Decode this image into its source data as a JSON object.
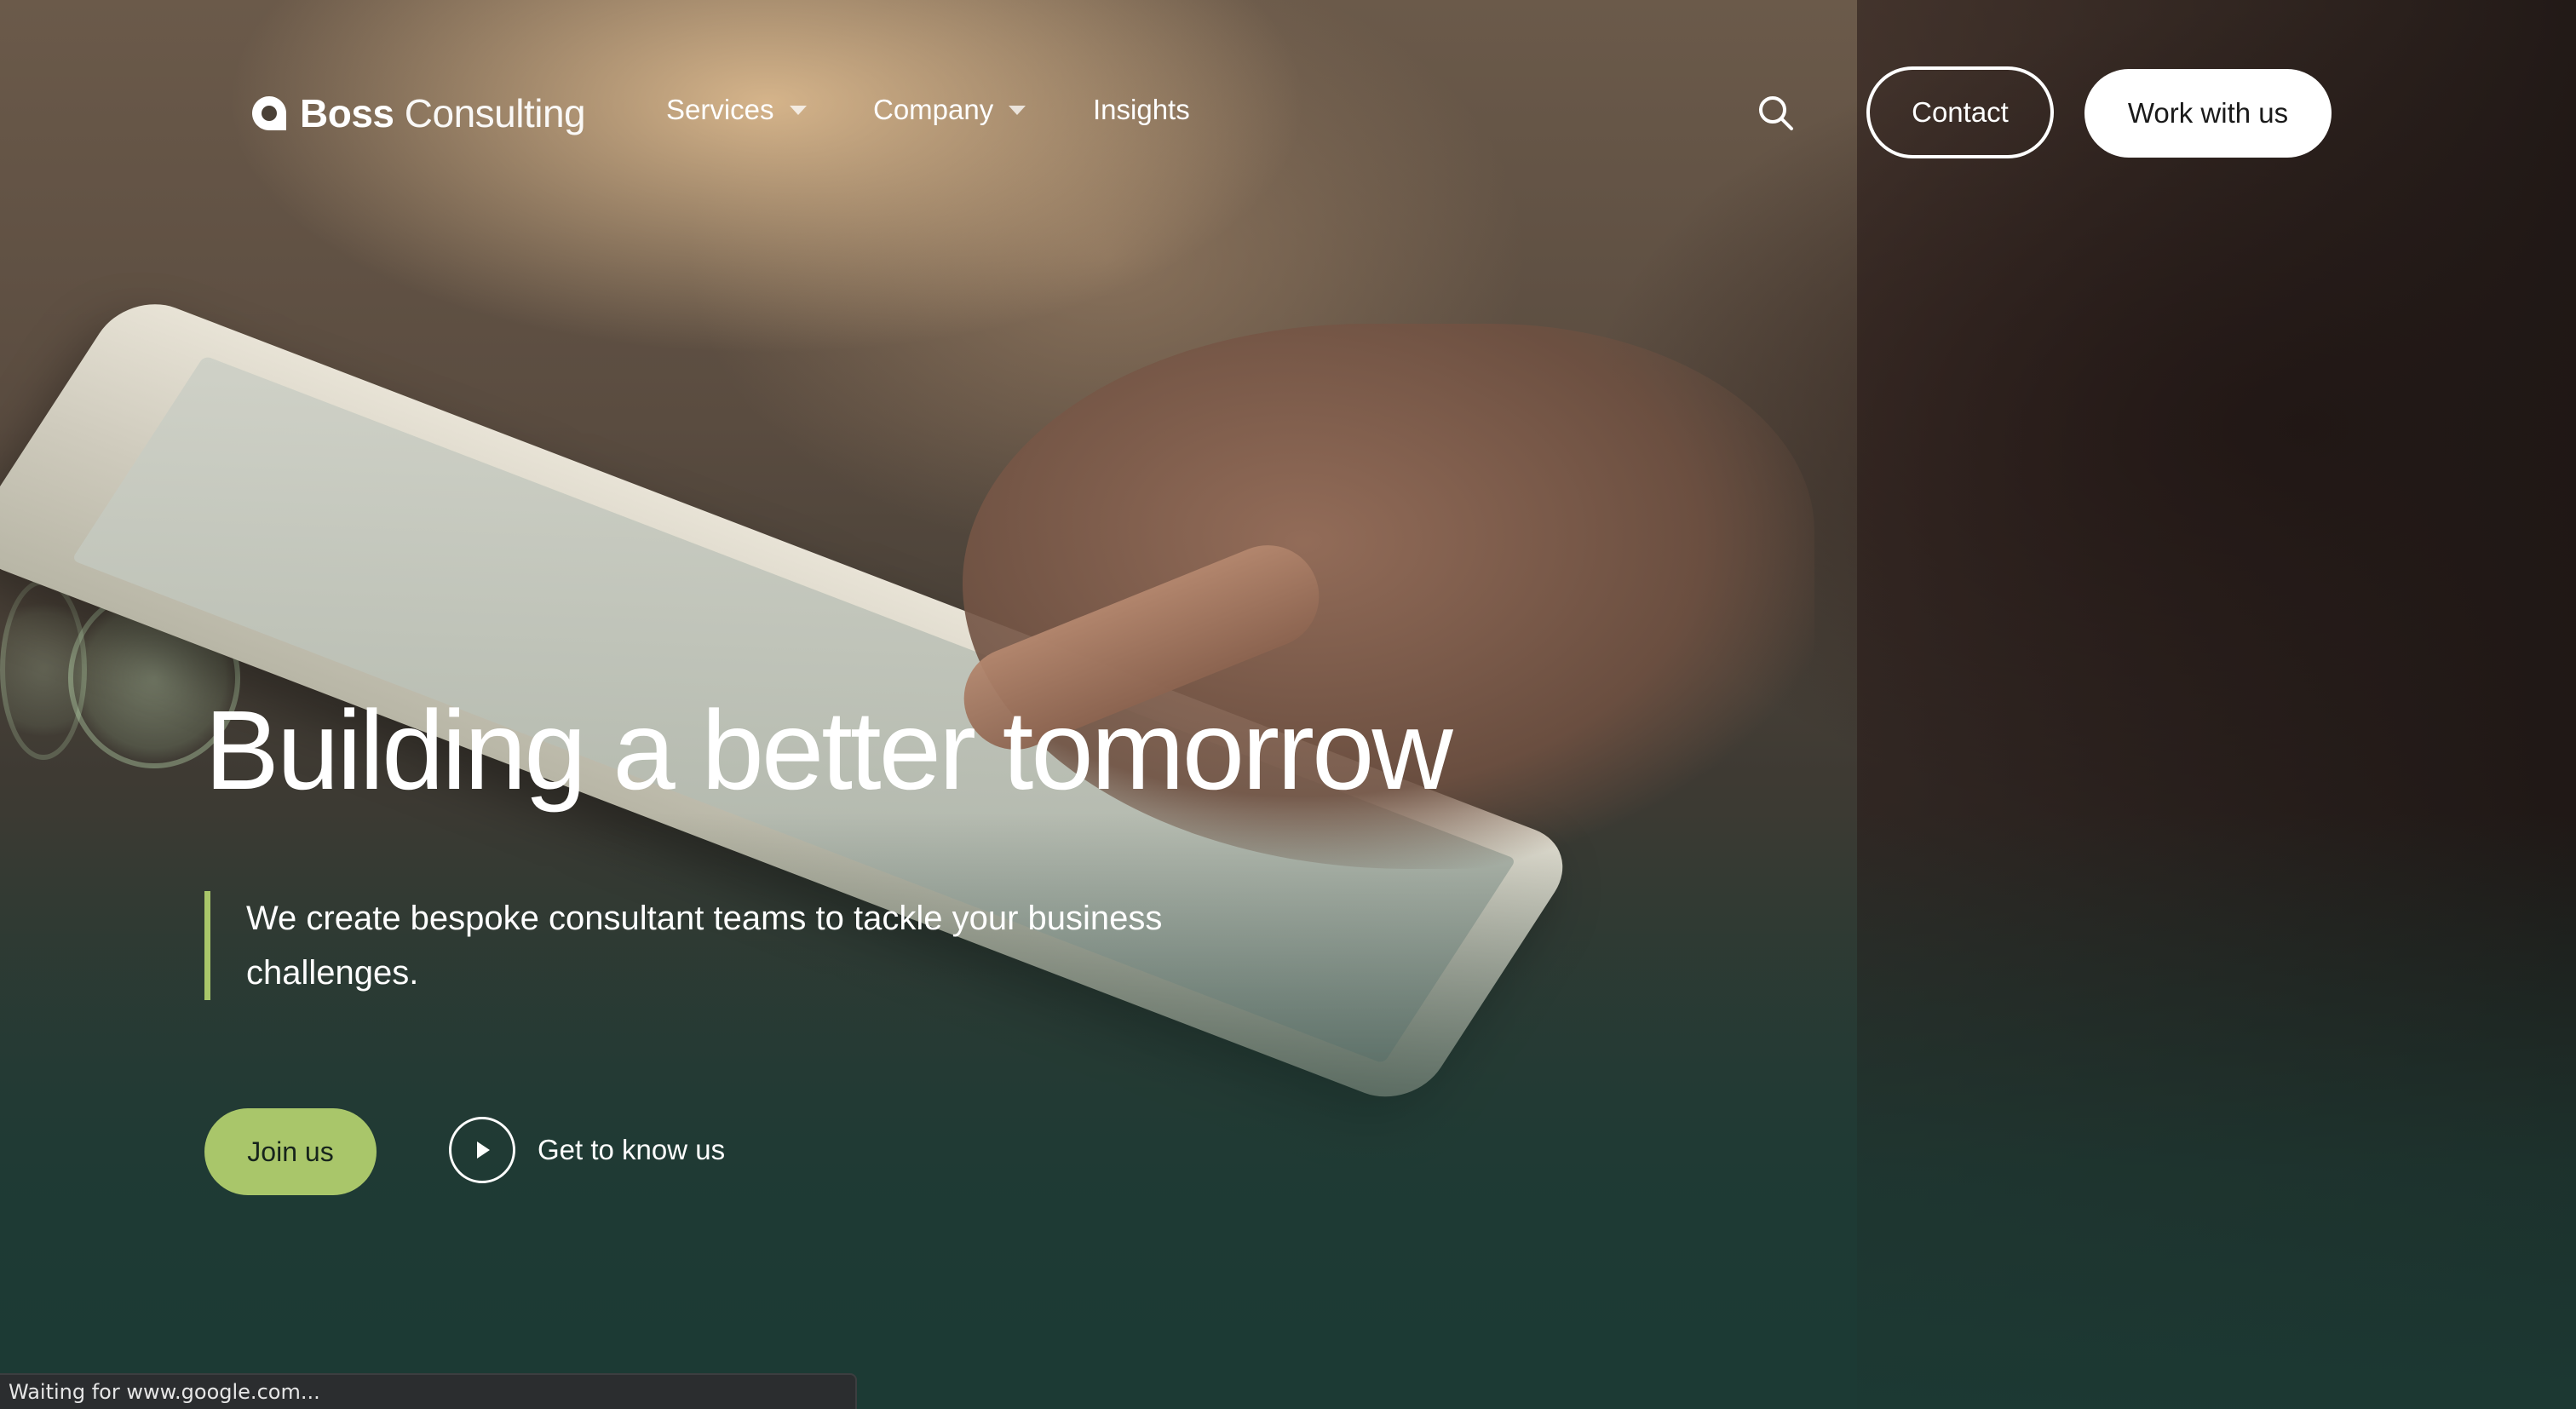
{
  "brand": {
    "name_bold": "Boss",
    "name_light": "Consulting",
    "logo_icon": "boss-logo-mark",
    "accent_color": "#a9c66a"
  },
  "nav": {
    "items": [
      {
        "label": "Services",
        "has_dropdown": true
      },
      {
        "label": "Company",
        "has_dropdown": true
      },
      {
        "label": "Insights",
        "has_dropdown": false
      }
    ],
    "search_icon": "search-icon"
  },
  "header_actions": {
    "contact_label": "Contact",
    "work_label": "Work with us"
  },
  "hero": {
    "title": "Building a better tomorrow",
    "subtitle": "We create bespoke consultant teams to tackle your business challenges.",
    "primary_cta": "Join us",
    "video_cta": "Get to know us",
    "video_icon": "play-icon"
  },
  "browser": {
    "status_text": "Waiting for www.google.com..."
  }
}
